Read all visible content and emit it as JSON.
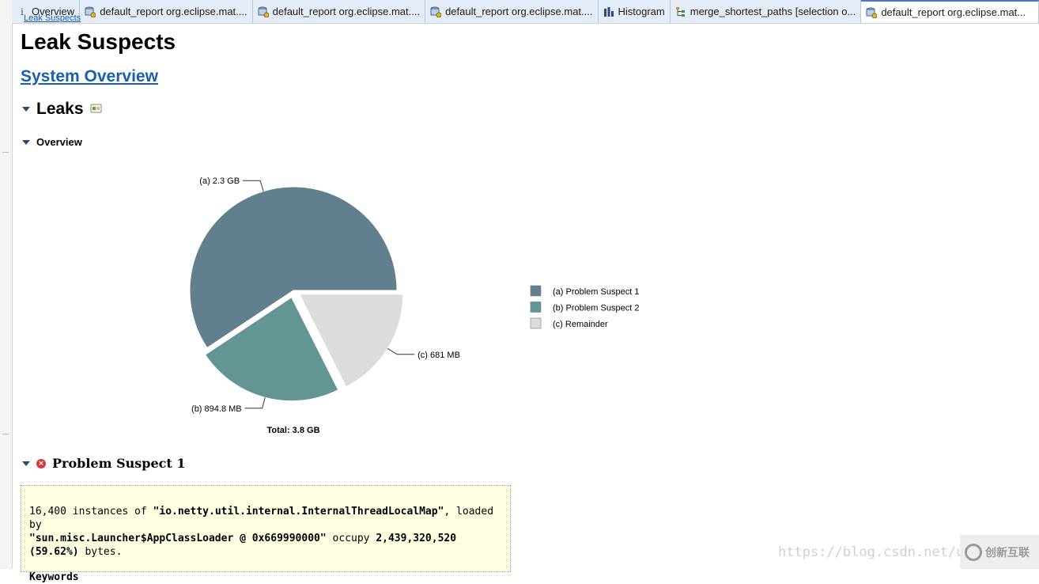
{
  "tabs": [
    {
      "label": "Overview",
      "icon": "info-icon"
    },
    {
      "label": "default_report  org.eclipse.mat....",
      "icon": "report-db-icon"
    },
    {
      "label": "default_report  org.eclipse.mat....",
      "icon": "report-db-icon"
    },
    {
      "label": "default_report  org.eclipse.mat....",
      "icon": "report-db-icon"
    },
    {
      "label": "Histogram",
      "icon": "histogram-icon"
    },
    {
      "label": "merge_shortest_paths [selection o...",
      "icon": "tree-icon"
    },
    {
      "label": "default_report  org.eclipse.mat...",
      "icon": "report-db-icon",
      "active": true
    }
  ],
  "breadcrumb": "Leak Suspects",
  "page_title": "Leak Suspects",
  "system_overview_link": "System Overview",
  "leaks_heading": "Leaks",
  "overview_heading": "Overview",
  "chart_data": {
    "type": "pie",
    "slices": [
      {
        "key": "(a)",
        "name": "Problem Suspect 1",
        "value": 2.3,
        "unit": "GB",
        "label": "(a)  2.3 GB",
        "color": "#627f8e"
      },
      {
        "key": "(b)",
        "name": "Problem Suspect 2",
        "value": 0.8948,
        "unit": "GB",
        "label": "(b)  894.8 MB",
        "color": "#639594"
      },
      {
        "key": "(c)",
        "name": "Remainder",
        "value": 0.681,
        "unit": "GB",
        "label": "(c)  681 MB",
        "color": "#dcdcdc"
      }
    ],
    "legend": [
      {
        "text": "(a)  Problem Suspect 1",
        "color": "#627f8e"
      },
      {
        "text": "(b)  Problem Suspect 2",
        "color": "#639594"
      },
      {
        "text": "(c)  Remainder",
        "color": "#dcdcdc"
      }
    ],
    "legend_position": "right",
    "total_label": "Total: 3.8 GB"
  },
  "problem_suspect": {
    "heading": "Problem Suspect 1",
    "desc_count": "16,400",
    "desc_instances_of": " instances of ",
    "desc_class": "\"io.netty.util.internal.InternalThreadLocalMap\"",
    "desc_loaded_by": ", loaded by",
    "desc_loader": "\"sun.misc.Launcher$AppClassLoader @ 0x669990000\"",
    "desc_occupy": " occupy ",
    "desc_bytes": "2,439,320,520",
    "desc_percent": "(59.62%)",
    "desc_bytes_word": " bytes.",
    "keywords_label": "Keywords"
  },
  "watermark": {
    "url": "https://blog.csdn.net/u",
    "brand": "创新互联"
  },
  "colors": {
    "link": "#1a5eb0",
    "tab_bar": "#e4ecf7",
    "note_bg": "#ffffe1"
  }
}
